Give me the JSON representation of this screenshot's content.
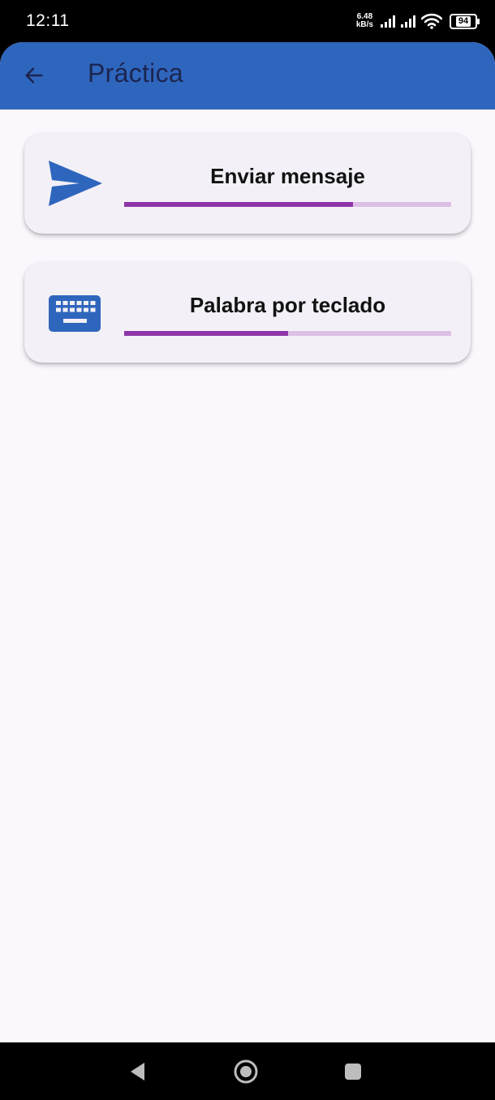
{
  "status_bar": {
    "time": "12:11",
    "net_speed_value": "6.48",
    "net_speed_unit": "kB/s",
    "battery": "94"
  },
  "app_bar": {
    "title": "Práctica",
    "back_icon": "arrow-back-icon",
    "color": "#2f66bd"
  },
  "cards": [
    {
      "label": "Enviar mensaje",
      "icon": "send-icon",
      "progress": 0.7
    },
    {
      "label": "Palabra por teclado",
      "icon": "keyboard-icon",
      "progress": 0.5
    }
  ],
  "nav_bar": {
    "back_icon": "nav-back-icon",
    "home_icon": "nav-home-icon",
    "recents_icon": "nav-recents-icon"
  },
  "colors": {
    "progress_fill": "#8e35a8",
    "progress_track": "#dcbfe6",
    "icon_blue": "#2f66bd",
    "background": "#fbf7fd"
  }
}
